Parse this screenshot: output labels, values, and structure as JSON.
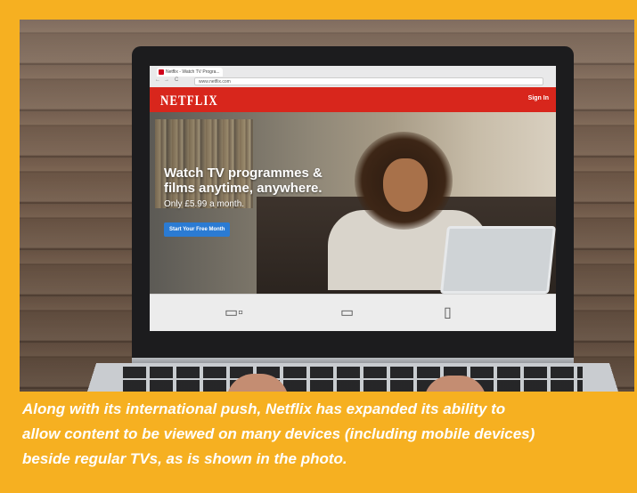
{
  "browser": {
    "tab_title": "Netflix - Watch TV Progra...",
    "url": "www.netflix.com"
  },
  "netflix": {
    "logo": "NETFLIX",
    "signin_label": "Sign In",
    "headline_line1": "Watch TV programmes &",
    "headline_line2": "films anytime, anywhere.",
    "subline": "Only £5.99 a month.",
    "cta_label": "Start Your Free Month",
    "brand_red": "#d8261c",
    "cta_blue": "#2b7bd3"
  },
  "devices": [
    "laptop-tablet-icon",
    "tv-icon",
    "phone-icon"
  ],
  "caption": {
    "line1": "Along with its international push, Netflix has expanded its ability to",
    "line2": "allow content to be viewed on many devices (including mobile devices)",
    "line3": "beside regular TVs, as is shown in the photo."
  },
  "frame_color": "#f6b021"
}
